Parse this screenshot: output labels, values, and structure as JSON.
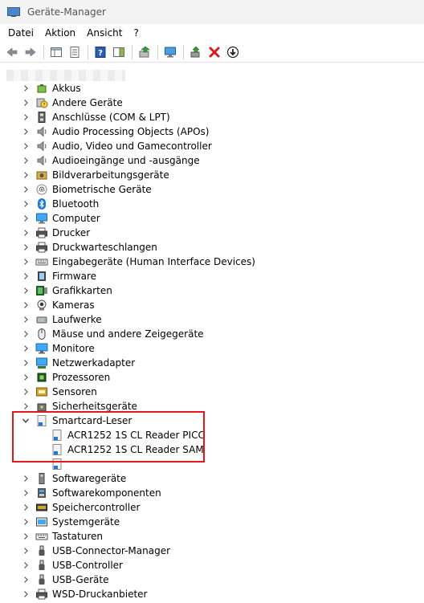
{
  "window": {
    "title": "Geräte-Manager"
  },
  "menu": {
    "items": [
      "Datei",
      "Aktion",
      "Ansicht",
      "?"
    ]
  },
  "tree": {
    "before": [
      {
        "label": "Akkus",
        "icon": "battery-icon"
      },
      {
        "label": "Andere Geräte",
        "icon": "unknown-device-icon"
      },
      {
        "label": "Anschlüsse (COM & LPT)",
        "icon": "port-icon"
      },
      {
        "label": "Audio Processing Objects (APOs)",
        "icon": "speaker-icon"
      },
      {
        "label": "Audio, Video und Gamecontroller",
        "icon": "speaker-icon"
      },
      {
        "label": "Audioeingänge und -ausgänge",
        "icon": "speaker-icon"
      },
      {
        "label": "Bildverarbeitungsgeräte",
        "icon": "imaging-icon"
      },
      {
        "label": "Biometrische Geräte",
        "icon": "fingerprint-icon"
      },
      {
        "label": "Bluetooth",
        "icon": "bluetooth-icon"
      },
      {
        "label": "Computer",
        "icon": "computer-icon"
      },
      {
        "label": "Drucker",
        "icon": "printer-icon"
      },
      {
        "label": "Druckwarteschlangen",
        "icon": "printer-icon"
      },
      {
        "label": "Eingabegeräte (Human Interface Devices)",
        "icon": "hid-icon"
      },
      {
        "label": "Firmware",
        "icon": "firmware-icon"
      },
      {
        "label": "Grafikkarten",
        "icon": "display-adapter-icon"
      },
      {
        "label": "Kameras",
        "icon": "camera-icon"
      },
      {
        "label": "Laufwerke",
        "icon": "drive-icon"
      },
      {
        "label": "Mäuse und andere Zeigegeräte",
        "icon": "mouse-icon"
      },
      {
        "label": "Monitore",
        "icon": "monitor-icon"
      },
      {
        "label": "Netzwerkadapter",
        "icon": "network-icon"
      },
      {
        "label": "Prozessoren",
        "icon": "processor-icon"
      },
      {
        "label": "Sensoren",
        "icon": "sensor-icon"
      },
      {
        "label": "Sicherheitsgeräte",
        "icon": "security-icon"
      }
    ],
    "expanded": {
      "label": "Smartcard-Leser",
      "icon": "smartcard-reader-icon",
      "children": [
        {
          "label": "ACR1252 1S CL Reader PICC",
          "icon": "smartcard-reader-icon"
        },
        {
          "label": "ACR1252 1S CL Reader SAM",
          "icon": "smartcard-reader-icon"
        },
        {
          "label": "",
          "icon": "smartcard-reader-icon"
        }
      ]
    },
    "after": [
      {
        "label": "Softwaregeräte",
        "icon": "software-device-icon"
      },
      {
        "label": "Softwarekomponenten",
        "icon": "software-component-icon"
      },
      {
        "label": "Speichercontroller",
        "icon": "storage-controller-icon"
      },
      {
        "label": "Systemgeräte",
        "icon": "system-device-icon"
      },
      {
        "label": "Tastaturen",
        "icon": "keyboard-icon"
      },
      {
        "label": "USB-Connector-Manager",
        "icon": "usb-icon"
      },
      {
        "label": "USB-Controller",
        "icon": "usb-icon"
      },
      {
        "label": "USB-Geräte",
        "icon": "usb-icon"
      },
      {
        "label": "WSD-Druckanbieter",
        "icon": "printer-icon"
      }
    ]
  },
  "colors": {
    "highlight": "#e8161b",
    "accent": "#0078d4"
  }
}
